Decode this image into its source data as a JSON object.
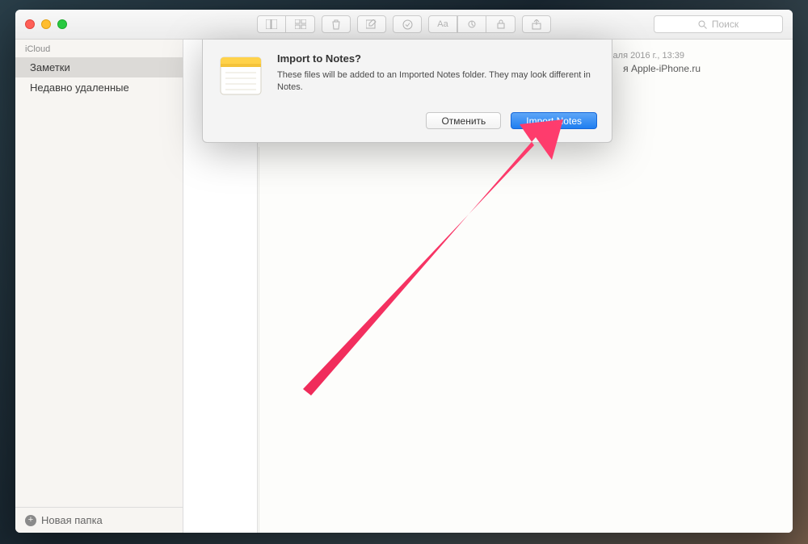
{
  "sidebar": {
    "header": "iCloud",
    "items": [
      {
        "label": "Заметки",
        "selected": true
      },
      {
        "label": "Недавно удаленные",
        "selected": false
      }
    ],
    "newFolder": "Новая папка"
  },
  "toolbar": {
    "searchPlaceholder": "Поиск"
  },
  "note": {
    "dateText": "аля 2016 г., 13:39",
    "sourceText": "я Apple-iPhone.ru"
  },
  "dialog": {
    "title": "Import to Notes?",
    "message": "These files will be added to an Imported Notes folder. They may look different in Notes.",
    "cancel": "Отменить",
    "confirm": "Import Notes"
  }
}
